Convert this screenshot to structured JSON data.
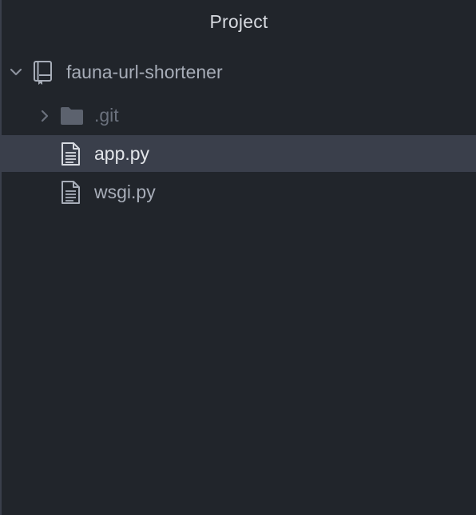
{
  "panel": {
    "title": "Project"
  },
  "tree": {
    "root": {
      "label": "fauna-url-shortener",
      "icon": "repo-icon",
      "expanded": true
    },
    "items": [
      {
        "label": ".git",
        "icon": "folder-icon",
        "expanded": false,
        "ignored": true
      },
      {
        "label": "app.py",
        "icon": "file-text-icon",
        "selected": true
      },
      {
        "label": "wsgi.py",
        "icon": "file-text-icon",
        "selected": false
      }
    ]
  },
  "colors": {
    "background": "#21252b",
    "selection": "#3a3f4b",
    "text": "#a7adb8",
    "text_selected": "#e3e6ea",
    "text_dim": "#6b717d"
  }
}
